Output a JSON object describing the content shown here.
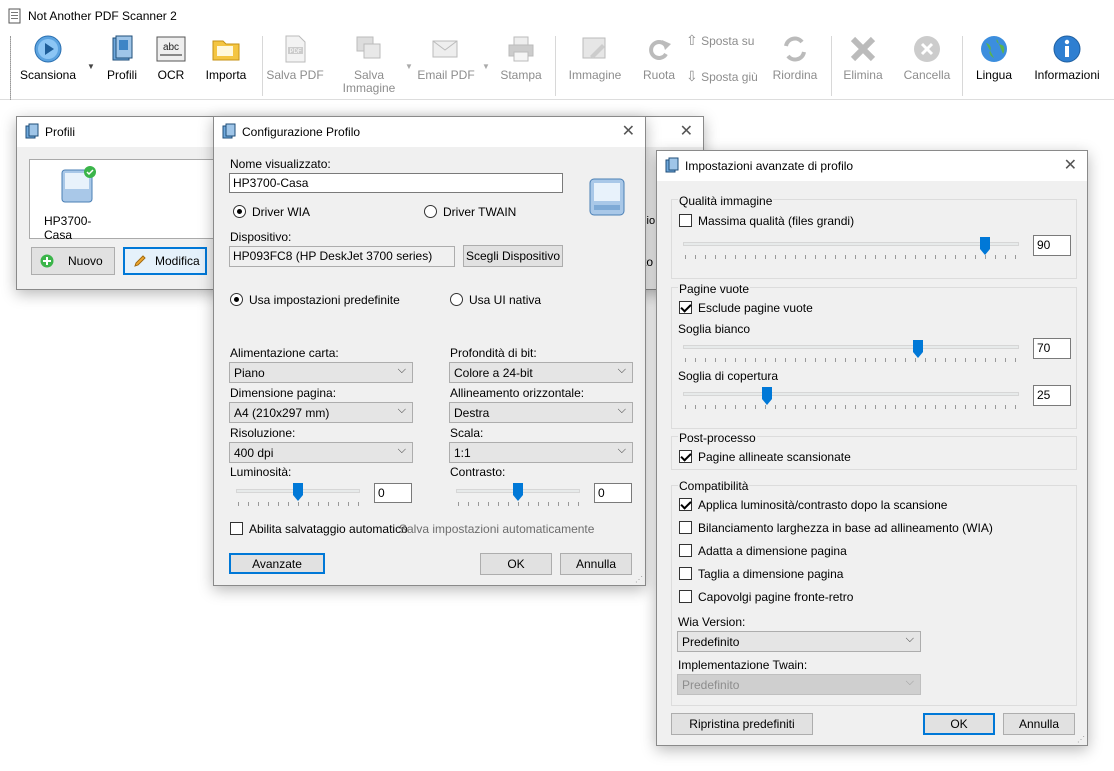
{
  "app": {
    "title": "Not Another PDF Scanner 2"
  },
  "toolbar": {
    "scan": "Scansiona",
    "profiles": "Profili",
    "ocr": "OCR",
    "import": "Importa",
    "save_pdf": "Salva PDF",
    "save_image_line1": "Salva",
    "save_image_line2": "Immagine",
    "email_pdf": "Email PDF",
    "print": "Stampa",
    "image": "Immagine",
    "rotate": "Ruota",
    "move_up": "Sposta su",
    "move_down": "Sposta giù",
    "reorder": "Riordina",
    "delete": "Elimina",
    "clear": "Cancella",
    "language": "Lingua",
    "about": "Informazioni",
    "ocr_icon_text": "abc",
    "pdf_icon_text": "PDF"
  },
  "profiles_window": {
    "title": "Profili",
    "profile_name": "HP3700-Casa",
    "new_button": "Nuovo",
    "edit_button": "Modifica",
    "partial_text_1": "sio",
    "partial_text_2": "to"
  },
  "config_window": {
    "title": "Configurazione Profilo",
    "display_name_label": "Nome visualizzato:",
    "display_name_value": "HP3700-Casa",
    "driver_wia": "Driver WIA",
    "driver_twain": "Driver TWAIN",
    "device_label": "Dispositivo:",
    "device_value": "HP093FC8 (HP DeskJet 3700 series)",
    "choose_device": "Scegli Dispositivo",
    "use_predefined": "Usa impostazioni predefinite",
    "use_native_ui": "Usa UI nativa",
    "paper_source_label": "Alimentazione carta:",
    "paper_source_value": "Piano",
    "bit_depth_label": "Profondità di bit:",
    "bit_depth_value": "Colore a 24-bit",
    "page_size_label": "Dimensione pagina:",
    "page_size_value": "A4 (210x297 mm)",
    "h_align_label": "Allineamento orizzontale:",
    "h_align_value": "Destra",
    "resolution_label": "Risoluzione:",
    "resolution_value": "400 dpi",
    "scale_label": "Scala:",
    "scale_value": "1:1",
    "brightness_label": "Luminosità:",
    "brightness_value": "0",
    "contrast_label": "Contrasto:",
    "contrast_value": "0",
    "auto_save_label": "Abilita salvataggio automatico",
    "auto_save_settings": "Salva impostazioni automaticamente",
    "advanced_button": "Avanzate",
    "ok_button": "OK",
    "cancel_button": "Annulla",
    "driver": "wia",
    "ui_mode": "predefined",
    "brightness_level": 0.5,
    "contrast_level": 0.5
  },
  "advanced_window": {
    "title": "Impostazioni avanzate di profilo",
    "image_quality_group": "Qualità immagine",
    "max_quality_label": "Massima qualità (files grandi)",
    "max_quality_checked": false,
    "quality_value": "90",
    "quality_level": 0.9,
    "blank_pages_group": "Pagine vuote",
    "exclude_blank_label": "Esclude pagine vuote",
    "exclude_blank_checked": true,
    "white_threshold_label": "Soglia bianco",
    "white_threshold_value": "70",
    "white_threshold_level": 0.7,
    "coverage_threshold_label": "Soglia di copertura",
    "coverage_threshold_value": "25",
    "coverage_threshold_level": 0.25,
    "post_process_group": "Post-processo",
    "deskew_label": "Pagine allineate scansionate",
    "deskew_checked": true,
    "compat_group": "Compatibilità",
    "apply_bc_label": "Applica luminosità/contrasto dopo la scansione",
    "apply_bc_checked": true,
    "width_align_label": "Bilanciamento larghezza in base ad allineamento (WIA)",
    "width_align_checked": false,
    "fit_page_label": "Adatta a dimensione pagina",
    "fit_page_checked": false,
    "crop_page_label": "Taglia a dimensione pagina",
    "crop_page_checked": false,
    "flip_duplex_label": "Capovolgi pagine fronte-retro",
    "flip_duplex_checked": false,
    "wia_version_label": "Wia Version:",
    "wia_version_value": "Predefinito",
    "twain_impl_label": "Implementazione Twain:",
    "twain_impl_value": "Predefinito",
    "restore_defaults": "Ripristina predefiniti",
    "ok_button": "OK",
    "cancel_button": "Annulla"
  },
  "colors": {
    "accent": "#0078d7",
    "slider_thumb": "#0078d7",
    "disabled_text": "#8d8d8d",
    "window_bg": "#f0f0f0"
  }
}
